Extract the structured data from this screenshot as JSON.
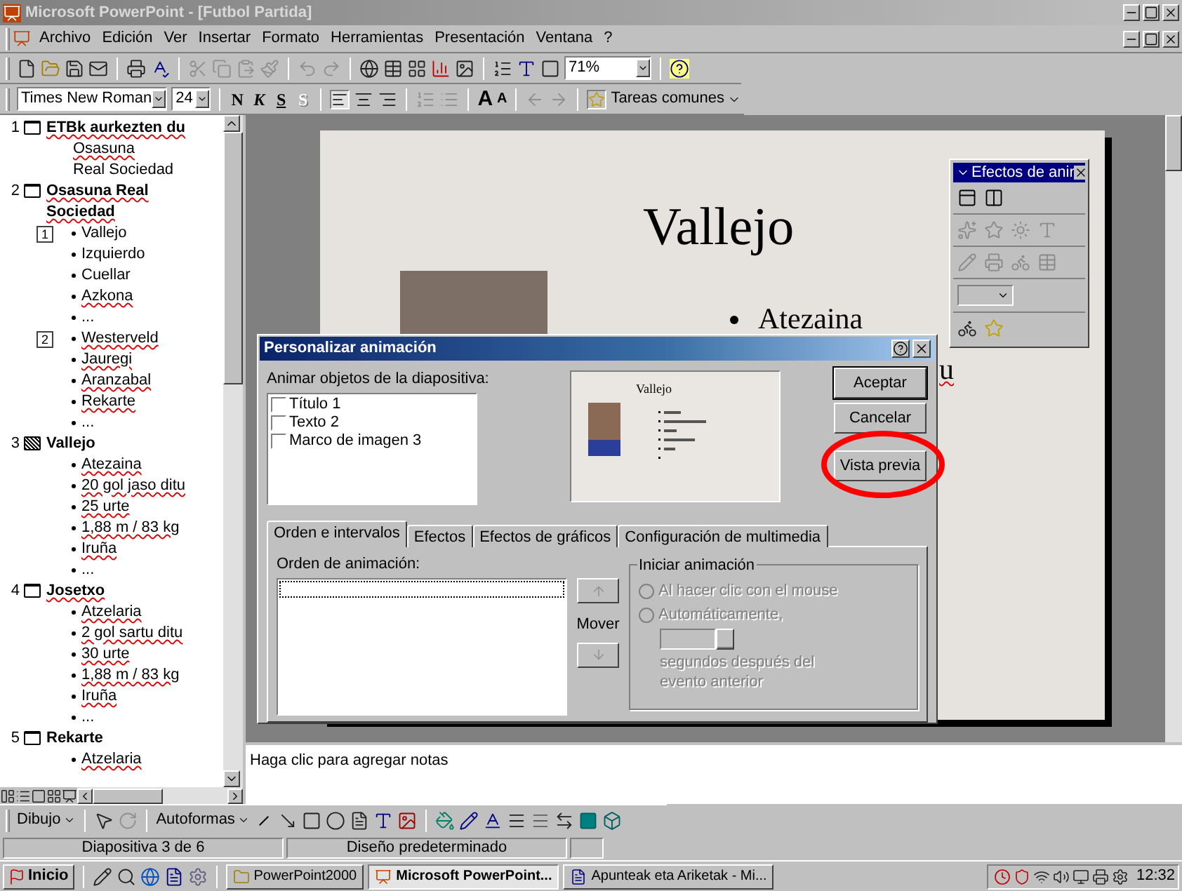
{
  "window": {
    "title": "Microsoft PowerPoint - [Futbol Partida]"
  },
  "menu": [
    {
      "label": "Archivo"
    },
    {
      "label": "Edición"
    },
    {
      "label": "Ver"
    },
    {
      "label": "Insertar"
    },
    {
      "label": "Formato"
    },
    {
      "label": "Herramientas"
    },
    {
      "label": "Presentación"
    },
    {
      "label": "Ventana"
    },
    {
      "label": "?"
    }
  ],
  "standard_toolbar": {
    "zoom": "71%"
  },
  "formatting_toolbar": {
    "font": "Times New Roman",
    "size": "24",
    "style_buttons": [
      "N",
      "K",
      "S",
      "S"
    ],
    "grow": "A",
    "shrink": "A",
    "common_tasks": "Tareas comunes"
  },
  "outline": [
    {
      "number": "1",
      "title": "ETBk aurkezten du",
      "title_misspelled": true,
      "selected": false,
      "blocks": [
        {
          "kind": "subtitle",
          "items": [
            {
              "text": "Osasuna",
              "misspelled": true
            },
            {
              "text": "Real Sociedad",
              "misspelled": false
            }
          ]
        }
      ]
    },
    {
      "number": "2",
      "title": "Osasuna Real Sociedad",
      "title_misspelled": true,
      "selected": false,
      "blocks": [
        {
          "kind": "bullets",
          "number": "1",
          "items": [
            {
              "text": "Vallejo",
              "misspelled": false
            },
            {
              "text": "Izquierdo",
              "misspelled": false
            },
            {
              "text": "Cuellar",
              "misspelled": false
            },
            {
              "text": "Azkona",
              "misspelled": true
            },
            {
              "text": "...",
              "misspelled": false
            }
          ]
        },
        {
          "kind": "bullets",
          "number": "2",
          "items": [
            {
              "text": "Westerveld",
              "misspelled": true
            },
            {
              "text": "Jauregi",
              "misspelled": true
            },
            {
              "text": "Aranzabal",
              "misspelled": true
            },
            {
              "text": "Rekarte",
              "misspelled": true
            },
            {
              "text": "...",
              "misspelled": false
            }
          ]
        }
      ]
    },
    {
      "number": "3",
      "title": "Vallejo",
      "title_misspelled": false,
      "selected": true,
      "blocks": [
        {
          "kind": "bullets",
          "items": [
            {
              "text": "Atezaina",
              "misspelled": true
            },
            {
              "text": "20  gol jaso ditu",
              "misspelled": true
            },
            {
              "text": "25 urte",
              "misspelled": true
            },
            {
              "text": "1,88 m / 83 kg",
              "misspelled": true
            },
            {
              "text": "Iruña",
              "misspelled": true
            },
            {
              "text": "...",
              "misspelled": false
            }
          ]
        }
      ]
    },
    {
      "number": "4",
      "title": "Josetxo",
      "title_misspelled": true,
      "selected": false,
      "blocks": [
        {
          "kind": "bullets",
          "items": [
            {
              "text": "Atzelaria",
              "misspelled": true
            },
            {
              "text": "2  gol sartu ditu",
              "misspelled": true
            },
            {
              "text": "30 urte",
              "misspelled": true
            },
            {
              "text": "1,88 m / 83 kg",
              "misspelled": true
            },
            {
              "text": "Iruña",
              "misspelled": true
            },
            {
              "text": "...",
              "misspelled": false
            }
          ]
        }
      ]
    },
    {
      "number": "5",
      "title": "Rekarte",
      "title_misspelled": false,
      "selected": false,
      "blocks": [
        {
          "kind": "bullets",
          "items": [
            {
              "text": "Atzelaria",
              "misspelled": true
            }
          ]
        }
      ]
    }
  ],
  "slide": {
    "title": "Vallejo",
    "bullets": [
      {
        "text": "Atezaina"
      }
    ],
    "fragment": "u"
  },
  "effects_toolbar": {
    "title": "Efectos de anir"
  },
  "dialog": {
    "title": "Personalizar animación",
    "objects_label": "Animar objetos de la diapositiva:",
    "objects": [
      {
        "label": "Título 1",
        "checked": false
      },
      {
        "label": "Texto 2",
        "checked": false
      },
      {
        "label": "Marco de imagen 3",
        "checked": false
      }
    ],
    "preview": {
      "title": "Vallejo"
    },
    "buttons": [
      {
        "label": "Aceptar"
      },
      {
        "label": "Cancelar"
      },
      {
        "label": "Vista previa"
      }
    ],
    "tabs": [
      {
        "label": "Orden e intervalos",
        "selected": true
      },
      {
        "label": "Efectos",
        "selected": false
      },
      {
        "label": "Efectos de gráficos",
        "selected": false
      },
      {
        "label": "Configuración de multimedia",
        "selected": false
      }
    ],
    "order_label": "Orden de animación:",
    "move_label": "Mover",
    "move_disabled": true,
    "start_group": {
      "title": "Iniciar animación",
      "disabled": true,
      "options": [
        {
          "label": "Al hacer clic con el mouse",
          "selected": false
        },
        {
          "label": "Automáticamente,",
          "selected": false
        }
      ],
      "delay_note": "segundos después del evento anterior"
    }
  },
  "notes": {
    "placeholder": "Haga clic para agregar notas"
  },
  "drawing_toolbar": {
    "draw_menu": "Dibujo",
    "autoshapes": "Autoformas"
  },
  "status_bar": {
    "slide": "Diapositiva 3 de 6",
    "design": "Diseño predeterminado"
  },
  "taskbar": {
    "start": "Inicio",
    "tasks": [
      {
        "label": "PowerPoint2000",
        "selected": false
      },
      {
        "label": "Microsoft PowerPoint...",
        "selected": true
      },
      {
        "label": "Apunteak eta Ariketak - Mi...",
        "selected": false
      }
    ],
    "clock": "12:32"
  }
}
